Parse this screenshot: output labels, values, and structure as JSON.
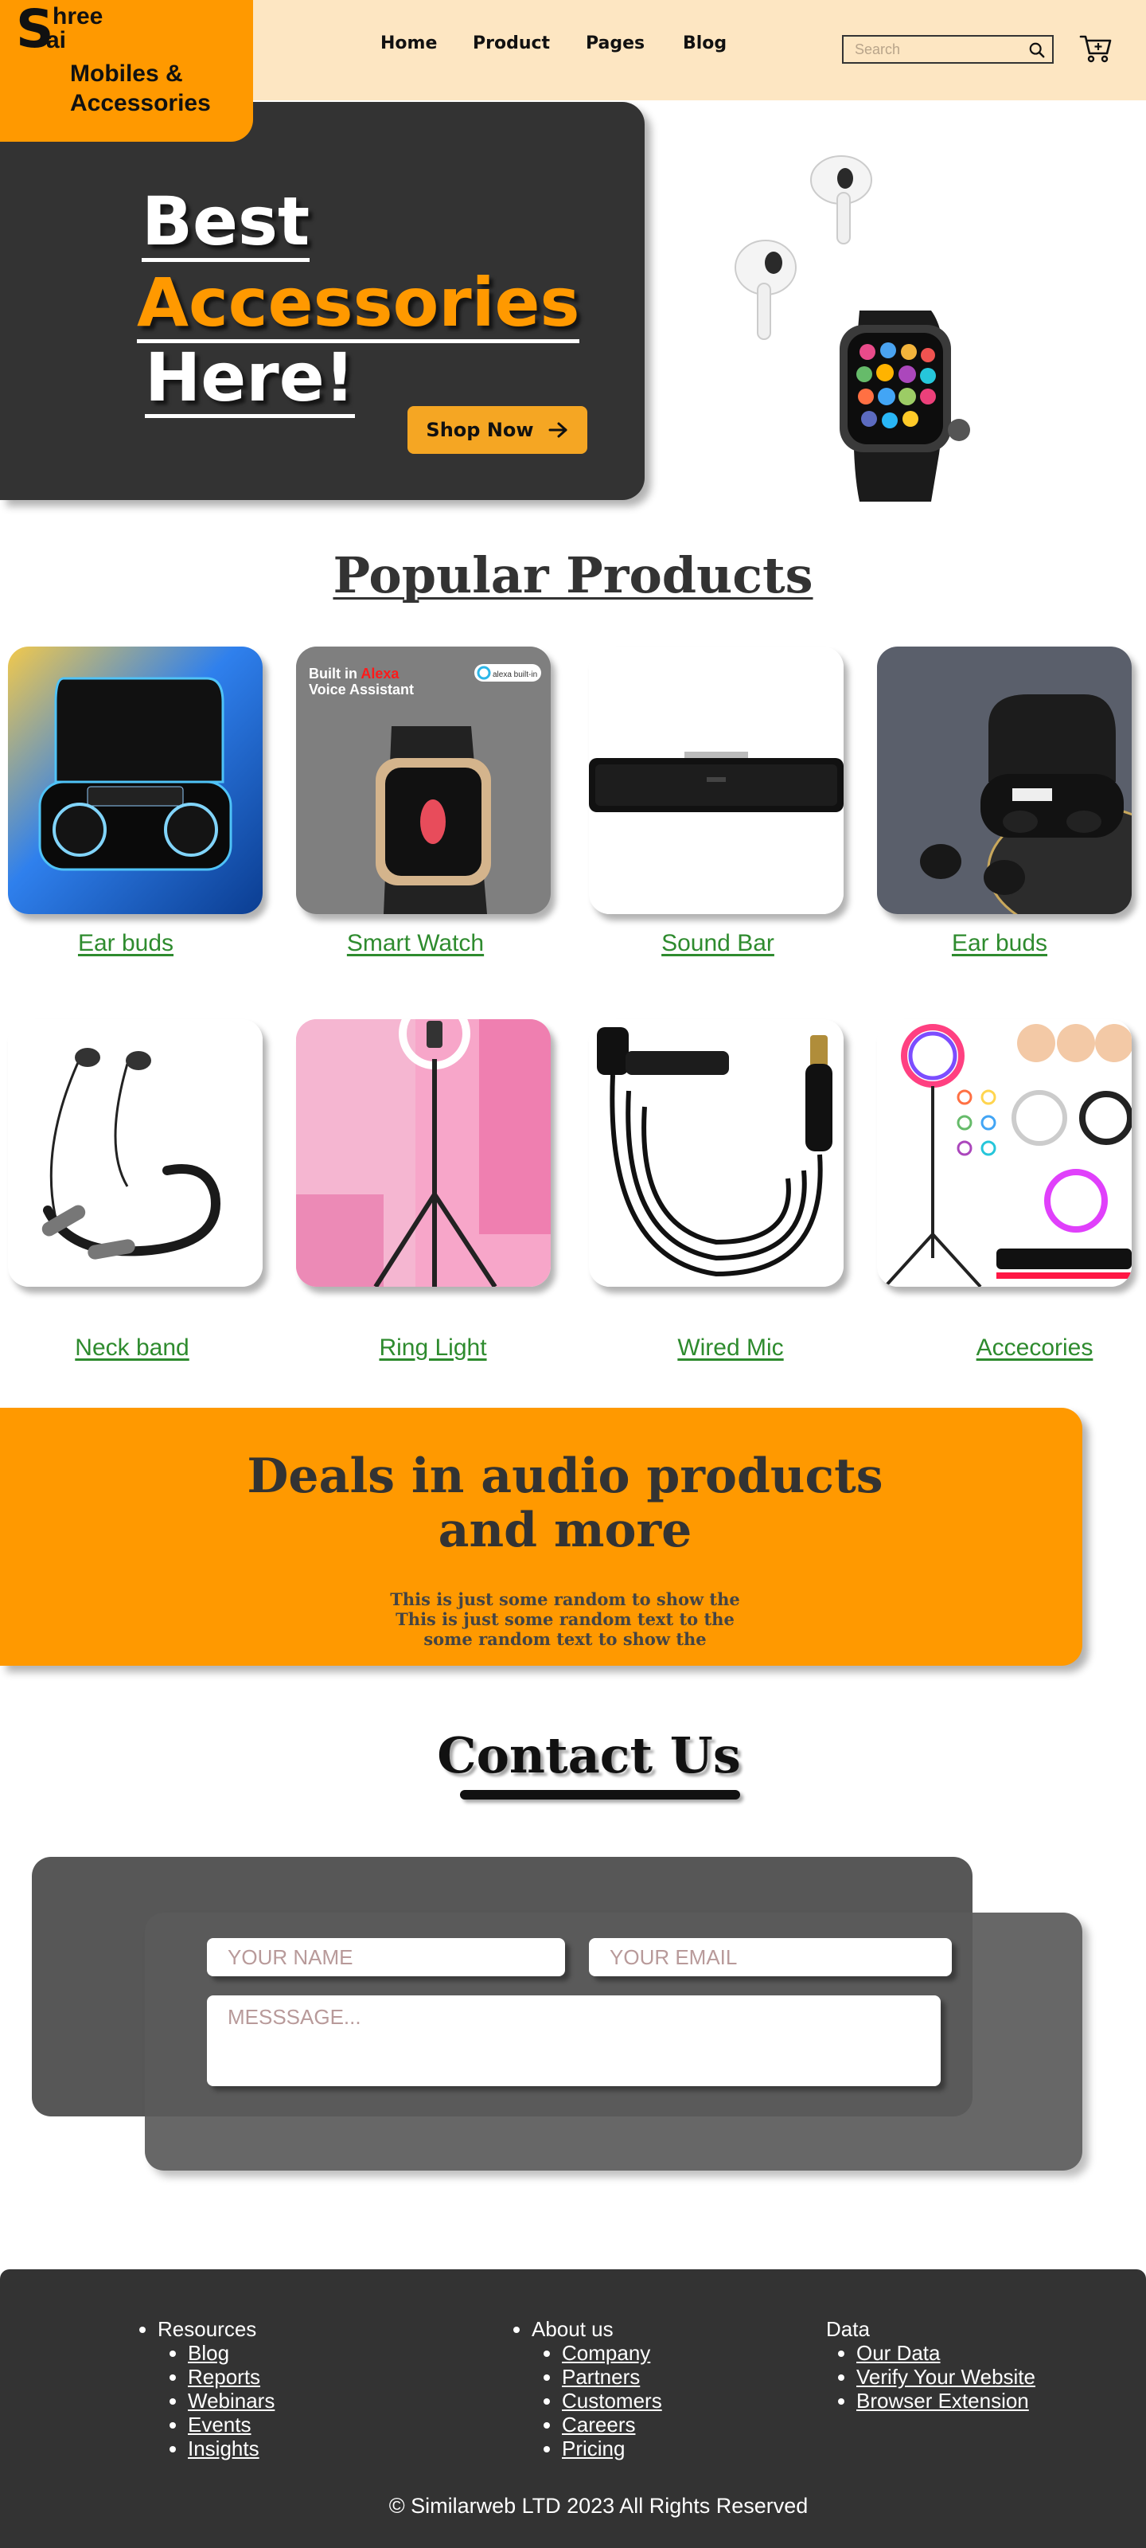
{
  "brand": {
    "initial": "S",
    "line1": "hree",
    "line2": "ai",
    "subtitle": "Mobiles & Accessories"
  },
  "nav": {
    "items": [
      "Home",
      "Product",
      "Pages",
      "Blog"
    ]
  },
  "search": {
    "placeholder": "Search"
  },
  "hero": {
    "line1": "Best",
    "line2": "Accessories",
    "line3": "Here!",
    "cta": "Shop Now"
  },
  "popular": {
    "title": "Popular Products",
    "products": [
      {
        "name": "Ear buds"
      },
      {
        "name": "Smart Watch",
        "banner_line1": "Built in ",
        "banner_brand": "Alexa",
        "banner_line2": "Voice Assistant",
        "badge": "alexa built-in"
      },
      {
        "name": "Sound Bar"
      },
      {
        "name": "Ear buds"
      },
      {
        "name": "Neck band"
      },
      {
        "name": "Ring Light"
      },
      {
        "name": "Wired Mic"
      },
      {
        "name": "Accecories"
      }
    ]
  },
  "deals": {
    "title_line1": "Deals in audio products",
    "title_line2": "and more",
    "text_line1": "This is just some random to show the",
    "text_line2": "This is just some random text to  the",
    "text_line3": "some random text to show the"
  },
  "contact": {
    "title": "Contact Us",
    "name_placeholder": "YOUR NAME",
    "email_placeholder": "YOUR EMAIL",
    "message_placeholder": "MESSSAGE..."
  },
  "footer": {
    "columns": [
      {
        "heading": "Resources",
        "links": [
          "Blog",
          "Reports",
          "Webinars",
          "Events",
          "Insights"
        ]
      },
      {
        "heading": "About us",
        "links": [
          "Company",
          "Partners",
          "Customers",
          "Careers",
          "Pricing"
        ]
      },
      {
        "heading": "Data",
        "links": [
          "Our Data",
          "Verify Your Website",
          "Browser Extension"
        ]
      }
    ],
    "copyright": "© Similarweb LTD 2023 All Rights Reserved"
  },
  "colors": {
    "accent": "#ff9900",
    "header_bg": "#fde6c2",
    "dark_panel": "#333333",
    "link_green": "#2e8b2e"
  }
}
